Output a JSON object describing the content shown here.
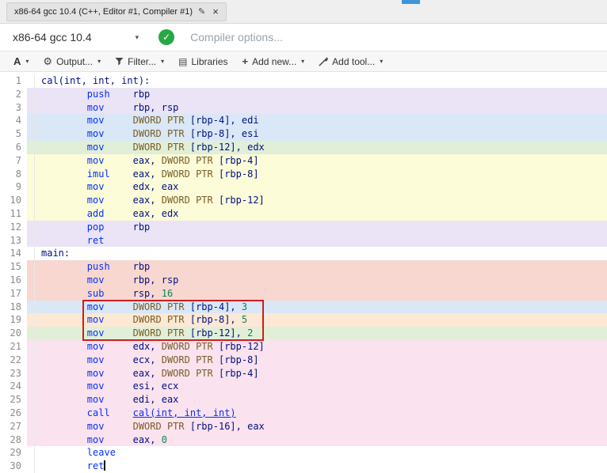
{
  "tab": {
    "title": "x86-64 gcc 10.4 (C++, Editor #1, Compiler #1)"
  },
  "icons": {
    "edit": "✎",
    "close": "×",
    "caret": "▾",
    "gear": "⚙",
    "book": "▤",
    "plus": "+",
    "check": "✓",
    "font": "A"
  },
  "compiler_row": {
    "selected": "x86-64 gcc 10.4",
    "options_placeholder": "Compiler options...",
    "status": "compiled-ok"
  },
  "toolbar": {
    "output_label": "Output...",
    "filter_label": "Filter...",
    "libraries_label": "Libraries",
    "add_new_label": "Add new...",
    "add_tool_label": "Add tool..."
  },
  "colors": {
    "accent_blue": "#3d96d9",
    "status_green": "#28a745",
    "annotation_red": "#cf1d1d",
    "line_bg": {
      "purple": "#ebe3f6",
      "blue": "#d9e7f6",
      "green": "#e1efd8",
      "yellow": "#fcfcd8",
      "red": "#f7d7d0",
      "orange": "#fce8d4",
      "pink": "#fae2ee"
    }
  },
  "code": {
    "lines": [
      {
        "n": 1,
        "bg": "",
        "s": [
          [
            "label",
            "cal(int, int, int):"
          ]
        ]
      },
      {
        "n": 2,
        "bg": "purple",
        "s": [
          [
            "w",
            "        "
          ],
          [
            "mn",
            "push"
          ],
          [
            "w",
            "    "
          ],
          [
            "reg",
            "rbp"
          ]
        ]
      },
      {
        "n": 3,
        "bg": "purple",
        "s": [
          [
            "w",
            "        "
          ],
          [
            "mn",
            "mov"
          ],
          [
            "w",
            "     "
          ],
          [
            "reg",
            "rbp, rsp"
          ]
        ]
      },
      {
        "n": 4,
        "bg": "blue",
        "s": [
          [
            "w",
            "        "
          ],
          [
            "mn",
            "mov"
          ],
          [
            "w",
            "     "
          ],
          [
            "ptr",
            "DWORD PTR "
          ],
          [
            "reg",
            "[rbp-4], edi"
          ]
        ]
      },
      {
        "n": 5,
        "bg": "blue",
        "s": [
          [
            "w",
            "        "
          ],
          [
            "mn",
            "mov"
          ],
          [
            "w",
            "     "
          ],
          [
            "ptr",
            "DWORD PTR "
          ],
          [
            "reg",
            "[rbp-8], esi"
          ]
        ]
      },
      {
        "n": 6,
        "bg": "green",
        "s": [
          [
            "w",
            "        "
          ],
          [
            "mn",
            "mov"
          ],
          [
            "w",
            "     "
          ],
          [
            "ptr",
            "DWORD PTR "
          ],
          [
            "reg",
            "[rbp-12], edx"
          ]
        ]
      },
      {
        "n": 7,
        "bg": "yellow",
        "s": [
          [
            "w",
            "        "
          ],
          [
            "mn",
            "mov"
          ],
          [
            "w",
            "     "
          ],
          [
            "reg",
            "eax, "
          ],
          [
            "ptr",
            "DWORD PTR "
          ],
          [
            "reg",
            "[rbp-4]"
          ]
        ]
      },
      {
        "n": 8,
        "bg": "yellow",
        "s": [
          [
            "w",
            "        "
          ],
          [
            "mn",
            "imul"
          ],
          [
            "w",
            "    "
          ],
          [
            "reg",
            "eax, "
          ],
          [
            "ptr",
            "DWORD PTR "
          ],
          [
            "reg",
            "[rbp-8]"
          ]
        ]
      },
      {
        "n": 9,
        "bg": "yellow",
        "s": [
          [
            "w",
            "        "
          ],
          [
            "mn",
            "mov"
          ],
          [
            "w",
            "     "
          ],
          [
            "reg",
            "edx, eax"
          ]
        ]
      },
      {
        "n": 10,
        "bg": "yellow",
        "s": [
          [
            "w",
            "        "
          ],
          [
            "mn",
            "mov"
          ],
          [
            "w",
            "     "
          ],
          [
            "reg",
            "eax, "
          ],
          [
            "ptr",
            "DWORD PTR "
          ],
          [
            "reg",
            "[rbp-12]"
          ]
        ]
      },
      {
        "n": 11,
        "bg": "yellow",
        "s": [
          [
            "w",
            "        "
          ],
          [
            "mn",
            "add"
          ],
          [
            "w",
            "     "
          ],
          [
            "reg",
            "eax, edx"
          ]
        ]
      },
      {
        "n": 12,
        "bg": "purple",
        "s": [
          [
            "w",
            "        "
          ],
          [
            "mn",
            "pop"
          ],
          [
            "w",
            "     "
          ],
          [
            "reg",
            "rbp"
          ]
        ]
      },
      {
        "n": 13,
        "bg": "purple",
        "s": [
          [
            "w",
            "        "
          ],
          [
            "mn",
            "ret"
          ]
        ]
      },
      {
        "n": 14,
        "bg": "",
        "s": [
          [
            "label",
            "main:"
          ]
        ]
      },
      {
        "n": 15,
        "bg": "red",
        "s": [
          [
            "w",
            "        "
          ],
          [
            "mn",
            "push"
          ],
          [
            "w",
            "    "
          ],
          [
            "reg",
            "rbp"
          ]
        ]
      },
      {
        "n": 16,
        "bg": "red",
        "s": [
          [
            "w",
            "        "
          ],
          [
            "mn",
            "mov"
          ],
          [
            "w",
            "     "
          ],
          [
            "reg",
            "rbp, rsp"
          ]
        ]
      },
      {
        "n": 17,
        "bg": "red",
        "s": [
          [
            "w",
            "        "
          ],
          [
            "mn",
            "sub"
          ],
          [
            "w",
            "     "
          ],
          [
            "reg",
            "rsp, "
          ],
          [
            "num",
            "16"
          ]
        ]
      },
      {
        "n": 18,
        "bg": "blue",
        "box": true,
        "s": [
          [
            "w",
            "        "
          ],
          [
            "mn",
            "mov"
          ],
          [
            "w",
            "     "
          ],
          [
            "ptr",
            "DWORD PTR "
          ],
          [
            "reg",
            "[rbp-4], "
          ],
          [
            "num",
            "3"
          ]
        ]
      },
      {
        "n": 19,
        "bg": "orange",
        "box": true,
        "s": [
          [
            "w",
            "        "
          ],
          [
            "mn",
            "mov"
          ],
          [
            "w",
            "     "
          ],
          [
            "ptr",
            "DWORD PTR "
          ],
          [
            "reg",
            "[rbp-8], "
          ],
          [
            "num",
            "5"
          ]
        ]
      },
      {
        "n": 20,
        "bg": "green",
        "box": true,
        "s": [
          [
            "w",
            "        "
          ],
          [
            "mn",
            "mov"
          ],
          [
            "w",
            "     "
          ],
          [
            "ptr",
            "DWORD PTR "
          ],
          [
            "reg",
            "[rbp-12], "
          ],
          [
            "num",
            "2"
          ]
        ]
      },
      {
        "n": 21,
        "bg": "pink",
        "s": [
          [
            "w",
            "        "
          ],
          [
            "mn",
            "mov"
          ],
          [
            "w",
            "     "
          ],
          [
            "reg",
            "edx, "
          ],
          [
            "ptr",
            "DWORD PTR "
          ],
          [
            "reg",
            "[rbp-12]"
          ]
        ]
      },
      {
        "n": 22,
        "bg": "pink",
        "s": [
          [
            "w",
            "        "
          ],
          [
            "mn",
            "mov"
          ],
          [
            "w",
            "     "
          ],
          [
            "reg",
            "ecx, "
          ],
          [
            "ptr",
            "DWORD PTR "
          ],
          [
            "reg",
            "[rbp-8]"
          ]
        ]
      },
      {
        "n": 23,
        "bg": "pink",
        "s": [
          [
            "w",
            "        "
          ],
          [
            "mn",
            "mov"
          ],
          [
            "w",
            "     "
          ],
          [
            "reg",
            "eax, "
          ],
          [
            "ptr",
            "DWORD PTR "
          ],
          [
            "reg",
            "[rbp-4]"
          ]
        ]
      },
      {
        "n": 24,
        "bg": "pink",
        "s": [
          [
            "w",
            "        "
          ],
          [
            "mn",
            "mov"
          ],
          [
            "w",
            "     "
          ],
          [
            "reg",
            "esi, ecx"
          ]
        ]
      },
      {
        "n": 25,
        "bg": "pink",
        "s": [
          [
            "w",
            "        "
          ],
          [
            "mn",
            "mov"
          ],
          [
            "w",
            "     "
          ],
          [
            "reg",
            "edi, eax"
          ]
        ]
      },
      {
        "n": 26,
        "bg": "pink",
        "s": [
          [
            "w",
            "        "
          ],
          [
            "mn",
            "call"
          ],
          [
            "w",
            "    "
          ],
          [
            "link",
            "cal(int, int, int)"
          ]
        ]
      },
      {
        "n": 27,
        "bg": "pink",
        "s": [
          [
            "w",
            "        "
          ],
          [
            "mn",
            "mov"
          ],
          [
            "w",
            "     "
          ],
          [
            "ptr",
            "DWORD PTR "
          ],
          [
            "reg",
            "[rbp-16], eax"
          ]
        ]
      },
      {
        "n": 28,
        "bg": "pink",
        "s": [
          [
            "w",
            "        "
          ],
          [
            "mn",
            "mov"
          ],
          [
            "w",
            "     "
          ],
          [
            "reg",
            "eax, "
          ],
          [
            "num",
            "0"
          ]
        ]
      },
      {
        "n": 29,
        "bg": "",
        "s": [
          [
            "w",
            "        "
          ],
          [
            "mn",
            "leave"
          ]
        ]
      },
      {
        "n": 30,
        "bg": "",
        "cur": true,
        "s": [
          [
            "w",
            "        "
          ],
          [
            "mn",
            "ret"
          ]
        ]
      }
    ]
  }
}
